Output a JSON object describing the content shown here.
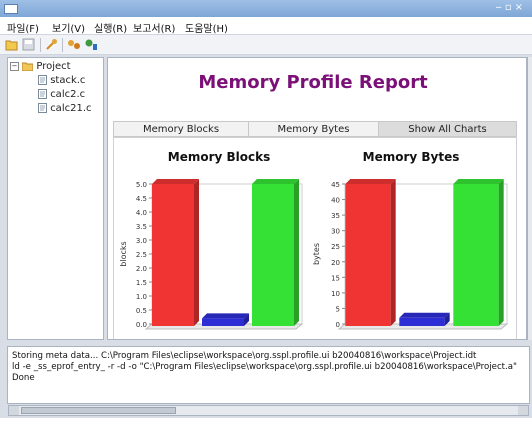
{
  "menu": [
    "파일(F)",
    "보기(V)",
    "실행(R)",
    "보고서(R)",
    "도움말(H)"
  ],
  "tree": {
    "root": "Project",
    "files": [
      "stack.c",
      "calc2.c",
      "calc21.c"
    ]
  },
  "report": {
    "title": "Memory Profile Report",
    "tabs": [
      "Memory Blocks",
      "Memory Bytes",
      "Show All Charts"
    ],
    "active_tab_index": 2
  },
  "chart_data": [
    {
      "type": "bar",
      "title": "Memory Blocks",
      "ylabel": "blocks",
      "xlabel": "",
      "categories": [
        "",
        "",
        ""
      ],
      "values": [
        5.0,
        0.2,
        5.0
      ],
      "colors": [
        "#f03434",
        "#2d2dd6",
        "#36e136"
      ],
      "ylim": [
        0,
        5.0
      ],
      "yticks": [
        "0.0",
        "0.5",
        "1.0",
        "1.5",
        "2.0",
        "2.5",
        "3.0",
        "3.5",
        "4.0",
        "4.5",
        "5.0"
      ],
      "grid": false
    },
    {
      "type": "bar",
      "title": "Memory Bytes",
      "ylabel": "bytes",
      "xlabel": "",
      "categories": [
        "",
        "",
        ""
      ],
      "values": [
        46,
        2,
        46
      ],
      "colors": [
        "#f03434",
        "#2d2dd6",
        "#36e136"
      ],
      "ylim": [
        0,
        45
      ],
      "yticks": [
        "0",
        "5",
        "10",
        "15",
        "20",
        "25",
        "30",
        "35",
        "40",
        "45"
      ],
      "grid": false
    }
  ],
  "console": {
    "lines": [
      "Storing meta data... C:\\Program Files\\eclipse\\workspace\\org.sspl.profile.ui b20040816\\workspace\\Project.idt",
      "ld -e _ss_eprof_entry_ -r -d -o \"C:\\Program Files\\eclipse\\workspace\\org.sspl.profile.ui b20040816\\workspace\\Project.a\"",
      "Done"
    ]
  }
}
